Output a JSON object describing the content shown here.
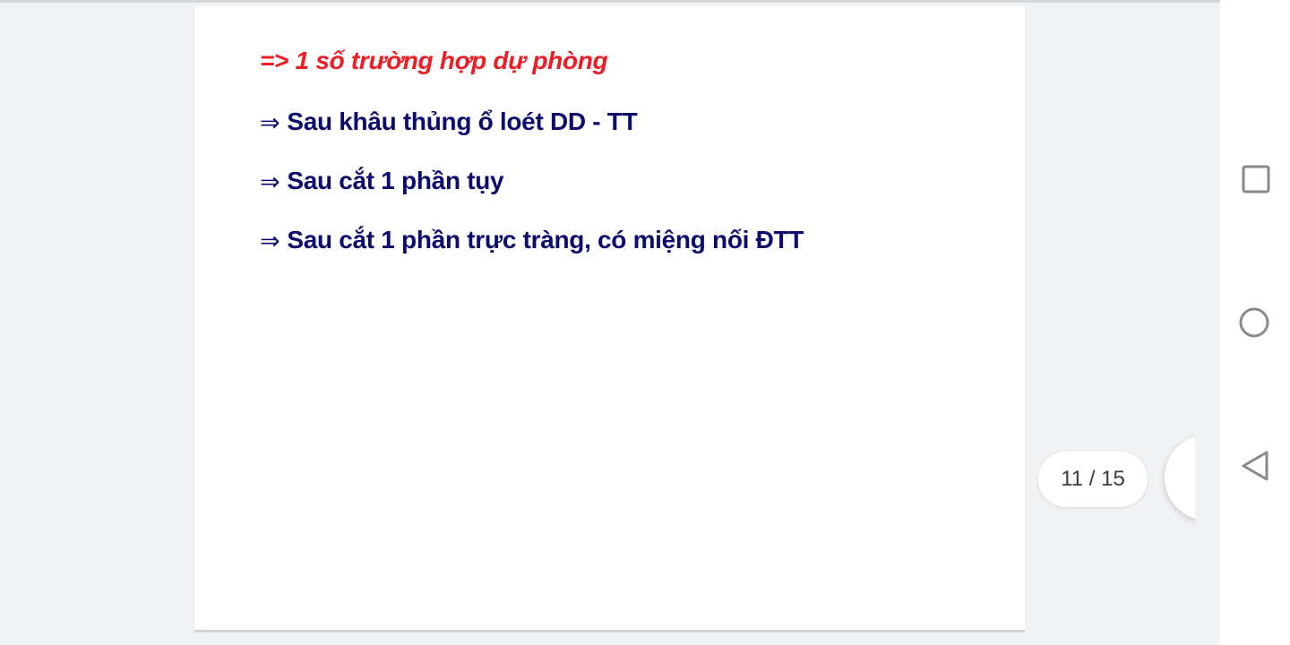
{
  "slide": {
    "heading": "=> 1 số trường hợp dự phòng",
    "bullet_arrow": "⇒",
    "bullets": [
      "Sau khâu thủng ổ loét DD - TT",
      "Sau cắt 1 phần tụy",
      "Sau cắt 1 phần trực tràng, có miệng nối ĐTT"
    ],
    "heading_color": "#ee1c24",
    "bullet_color": "#0d0c6e"
  },
  "viewer": {
    "page_indicator": "11 / 15",
    "current_page": 11,
    "total_pages": 15
  },
  "icons": {
    "scroll_control": "scroll-up-down-icon",
    "recents": "square-icon",
    "home": "circle-icon",
    "back": "triangle-back-icon"
  }
}
